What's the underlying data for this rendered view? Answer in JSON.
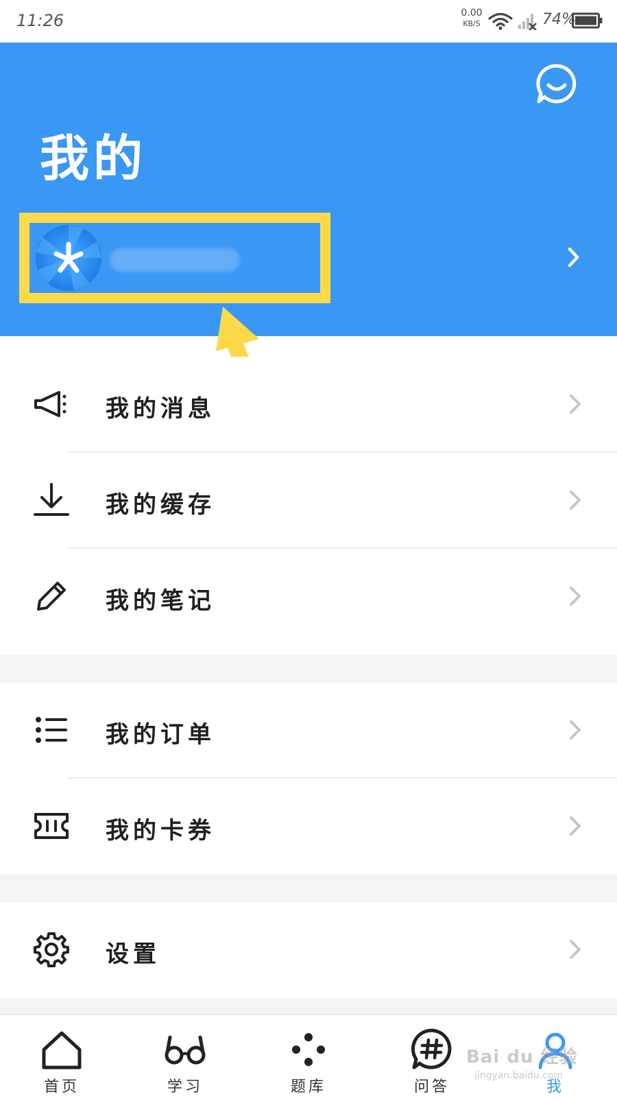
{
  "status_bar": {
    "time": "11:26",
    "net_speed_value": "0.00",
    "net_speed_unit": "KB/S",
    "battery": "74%"
  },
  "header": {
    "title": "我的",
    "username": "username"
  },
  "menu": {
    "group1": [
      {
        "label": "我的消息",
        "icon": "speaker-icon"
      },
      {
        "label": "我的缓存",
        "icon": "download-icon"
      },
      {
        "label": "我的笔记",
        "icon": "pencil-icon"
      }
    ],
    "group2": [
      {
        "label": "我的订单",
        "icon": "list-icon"
      },
      {
        "label": "我的卡券",
        "icon": "ticket-icon"
      }
    ],
    "group3": [
      {
        "label": "设置",
        "icon": "gear-icon"
      }
    ]
  },
  "bottom_nav": [
    {
      "label": "首页",
      "icon": "home-icon"
    },
    {
      "label": "学习",
      "icon": "glasses-icon"
    },
    {
      "label": "题库",
      "icon": "dots-icon"
    },
    {
      "label": "问答",
      "icon": "hashtag-chat-icon"
    },
    {
      "label": "我",
      "icon": "user-icon",
      "active": true
    }
  ],
  "watermark": {
    "brand": "Bai du 经验",
    "url": "jingyan.baidu.com"
  },
  "colors": {
    "brand_blue": "#3a97f4",
    "highlight_yellow": "#fcd949",
    "gap_gray": "#f3f4f6"
  }
}
